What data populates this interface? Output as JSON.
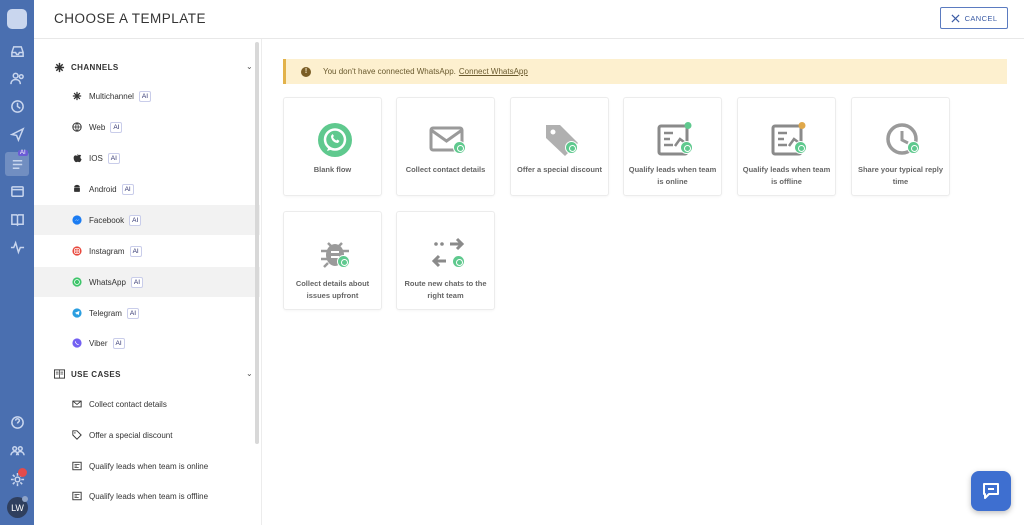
{
  "header": {
    "title": "CHOOSE A TEMPLATE",
    "cancel_label": "CANCEL"
  },
  "rail": {
    "avatar_initials": "LW",
    "ai_tag": "AI"
  },
  "sidebar": {
    "channels_heading": "CHANNELS",
    "use_cases_heading": "USE CASES",
    "ai_label": "AI",
    "channels": [
      {
        "label": "Multichannel",
        "icon": "multichannel-icon"
      },
      {
        "label": "Web",
        "icon": "globe-icon"
      },
      {
        "label": "IOS",
        "icon": "apple-icon"
      },
      {
        "label": "Android",
        "icon": "android-icon"
      },
      {
        "label": "Facebook",
        "icon": "messenger-icon"
      },
      {
        "label": "Instagram",
        "icon": "instagram-icon"
      },
      {
        "label": "WhatsApp",
        "icon": "whatsapp-icon"
      },
      {
        "label": "Telegram",
        "icon": "telegram-icon"
      },
      {
        "label": "Viber",
        "icon": "viber-icon"
      }
    ],
    "use_cases": [
      {
        "label": "Collect contact details",
        "icon": "envelope-icon"
      },
      {
        "label": "Offer a special discount",
        "icon": "tag-icon"
      },
      {
        "label": "Qualify leads when team is online",
        "icon": "chart-icon"
      },
      {
        "label": "Qualify leads when team is offline",
        "icon": "chart-icon"
      }
    ]
  },
  "banner": {
    "text": "You don't have connected WhatsApp.",
    "link": "Connect WhatsApp"
  },
  "templates": [
    {
      "label": "Blank flow",
      "icon": "whatsapp-icon"
    },
    {
      "label": "Collect contact details",
      "icon": "envelope-icon"
    },
    {
      "label": "Offer a special discount",
      "icon": "tag-icon"
    },
    {
      "label": "Qualify leads when team is online",
      "icon": "chart-icon"
    },
    {
      "label": "Qualify leads when team is offline",
      "icon": "chart-icon"
    },
    {
      "label": "Share your typical reply time",
      "icon": "clock-icon"
    },
    {
      "label": "Collect details about issues upfront",
      "icon": "bug-icon"
    },
    {
      "label": "Route new chats to the right team",
      "icon": "route-arrows-icon"
    }
  ],
  "colors": {
    "rail": "#4a6fb0",
    "accent": "#3b5ba5",
    "whatsapp": "#5fc98e",
    "banner": "#fdf0cf"
  }
}
